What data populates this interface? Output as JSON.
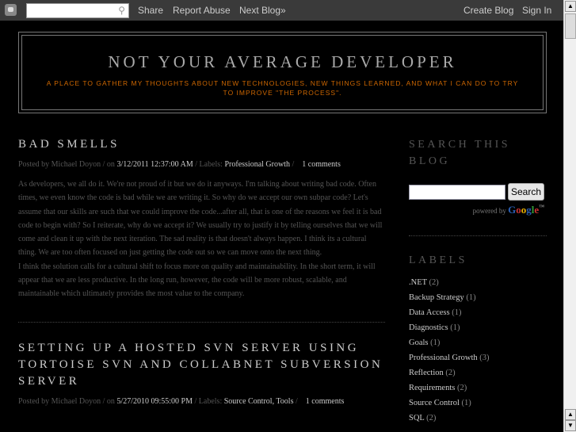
{
  "navbar": {
    "share": "Share",
    "report": "Report Abuse",
    "next": "Next Blog»",
    "create": "Create Blog",
    "signin": "Sign In"
  },
  "header": {
    "title": "NOT YOUR AVERAGE DEVELOPER",
    "tagline": "A PLACE TO GATHER MY THOUGHTS ABOUT NEW TECHNOLOGIES, NEW THINGS LEARNED, AND WHAT I CAN DO TO TRY TO IMPROVE \"THE PROCESS\"."
  },
  "posts": [
    {
      "title": "BAD SMELLS",
      "posted_by": "Posted by Michael Doyon / on ",
      "date": "3/12/2011 12:37:00 AM",
      "labels_prefix": " / Labels: ",
      "labels": "Professional Growth",
      "sep": " /    ",
      "comments": "1 comments",
      "body1": "As developers, we all do it. We're not proud of it but we do it anyways. I'm talking about writing bad code. Often times, we even know the code is bad while we are writing it. So why do we accept our own subpar code?  Let's assume that our skills are such that we could improve the code...after all, that is one of the reasons we feel it is bad code to begin with? So I reiterate, why do we accept it?  We usually try to justify it by telling ourselves that we will come and clean it up with the next iteration. The sad reality is that doesn't always happen.  I think its a cultural thing. We are too often focused on just getting the code out so we can move onto the next thing.",
      "body2": "I think the solution calls for a cultural shift to focus more on quality and maintainability.  In the short term, it will appear that we are less productive. In the long run,  however, the code will be more robust, scalable, and maintainable which ultimately provides the most value to the company."
    },
    {
      "title": "SETTING UP A HOSTED SVN SERVER USING TORTOISE SVN AND COLLABNET SUBVERSION SERVER",
      "posted_by": "Posted by Michael Doyon / on ",
      "date": "5/27/2010 09:55:00 PM",
      "labels_prefix": " / Labels: ",
      "label1": "Source Control",
      "label2": "Tools",
      "sep": " /    ",
      "comments": "1 comments"
    }
  ],
  "sidebar": {
    "search_title": "SEARCH THIS BLOG",
    "search_button": "Search",
    "powered": "powered by ",
    "google": "Google",
    "tm": "™",
    "labels_title": "LABELS",
    "labels": [
      {
        "name": ".NET",
        "count": "(2)"
      },
      {
        "name": "Backup Strategy",
        "count": "(1)"
      },
      {
        "name": "Data Access",
        "count": "(1)"
      },
      {
        "name": "Diagnostics",
        "count": "(1)"
      },
      {
        "name": "Goals",
        "count": "(1)"
      },
      {
        "name": "Professional Growth",
        "count": "(3)"
      },
      {
        "name": "Reflection",
        "count": "(2)"
      },
      {
        "name": "Requirements",
        "count": "(2)"
      },
      {
        "name": "Source Control",
        "count": "(1)"
      },
      {
        "name": "SQL",
        "count": "(2)"
      }
    ]
  }
}
